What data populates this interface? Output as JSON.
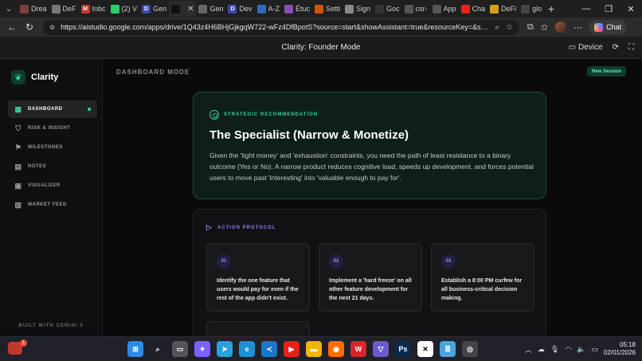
{
  "browser": {
    "tabs": [
      {
        "label": "Drea",
        "color": "#7b3f3f",
        "glyph": ""
      },
      {
        "label": "DeF",
        "color": "#777777",
        "glyph": ""
      },
      {
        "label": "Inbc",
        "color": "#c0392b",
        "glyph": "M"
      },
      {
        "label": "(2) V",
        "color": "#25d366",
        "glyph": ""
      },
      {
        "label": "Gen",
        "color": "#3c4aa8",
        "glyph": "D"
      },
      {
        "label": "",
        "color": "#111111",
        "glyph": "",
        "active": true
      },
      {
        "label": "Gen",
        "color": "#666666",
        "glyph": ""
      },
      {
        "label": "Dev",
        "color": "#3c4aa8",
        "glyph": "D"
      },
      {
        "label": "A-Z",
        "color": "#2f6bb8",
        "glyph": ""
      },
      {
        "label": "Étuc",
        "color": "#8a4fb0",
        "glyph": ""
      },
      {
        "label": "Setti",
        "color": "#d35400",
        "glyph": ""
      },
      {
        "label": "Sign",
        "color": "#888888",
        "glyph": ""
      },
      {
        "label": "Goc",
        "color": "#333333",
        "glyph": ""
      },
      {
        "label": "csr-",
        "color": "#555555",
        "glyph": ""
      },
      {
        "label": "App",
        "color": "#555555",
        "glyph": ""
      },
      {
        "label": "Cha",
        "color": "#e62117",
        "glyph": ""
      },
      {
        "label": "DeFi",
        "color": "#d4a017",
        "glyph": ""
      },
      {
        "label": "glo",
        "color": "#444444",
        "glyph": ""
      }
    ],
    "url": "https://aistudio.google.com/apps/drive/1Q43z4H6BHjGjkgqW722-wFz4DfBpotS?source=start&showAssistant=true&resourceKey=&sho...",
    "chat_label": "Chat"
  },
  "app_header": {
    "title": "Clarity: Founder Mode",
    "device_label": "Device"
  },
  "sidebar": {
    "brand": "Clarity",
    "items": [
      {
        "label": "DASHBOARD",
        "icon": "grid-icon",
        "glyph": "▦"
      },
      {
        "label": "RISK & INSIGHT",
        "icon": "shield-icon",
        "glyph": "⛉"
      },
      {
        "label": "MILESTONES",
        "icon": "flag-icon",
        "glyph": "⚑"
      },
      {
        "label": "NOTES",
        "icon": "document-icon",
        "glyph": "▤"
      },
      {
        "label": "VISUALIZER",
        "icon": "image-icon",
        "glyph": "▣"
      },
      {
        "label": "MARKET FEED",
        "icon": "newspaper-icon",
        "glyph": "▥"
      }
    ],
    "footer": "BUILT WITH GEMINI 3"
  },
  "main": {
    "mode_label": "DASHBOARD MODE",
    "new_session": "New Session",
    "recommendation": {
      "label": "STRATEGIC RECOMMENDATION",
      "title": "The Specialist (Narrow & Monetize)",
      "body": "Given the 'tight money' and 'exhaustion' constraints, you need the path of least resistance to a binary outcome (Yes or No). A narrow product reduces cognitive load, speeds up development, and forces potential users to move past 'interesting' into 'valuable enough to pay for'."
    },
    "protocol": {
      "label": "ACTION PROTOCOL",
      "steps": [
        {
          "num": "01",
          "text": "Identify the one feature that users would pay for even if the rest of the app didn't exist."
        },
        {
          "num": "02",
          "text": "Implement a 'hard freeze' on all other feature development for the next 21 days."
        },
        {
          "num": "03",
          "text": "Establish a 8:00 PM curfew for all business-critical decision making."
        }
      ]
    }
  },
  "taskbar": {
    "badge": "1",
    "time": "05:18",
    "date": "02/01/2026",
    "apps": [
      {
        "name": "windows-start-icon",
        "color": "#2b8be6",
        "glyph": "⊞"
      },
      {
        "name": "search-icon",
        "color": "#202028",
        "glyph": "⌕"
      },
      {
        "name": "task-view-icon",
        "color": "#555555",
        "glyph": "▭"
      },
      {
        "name": "copilot-icon",
        "color": "#7b61ff",
        "glyph": "✦"
      },
      {
        "name": "telegram-icon",
        "color": "#2aa1da",
        "glyph": "➤"
      },
      {
        "name": "edge-icon",
        "color": "#1f8fd6",
        "glyph": "e"
      },
      {
        "name": "vscode-icon",
        "color": "#1e76c8",
        "glyph": "≺"
      },
      {
        "name": "youtube-icon",
        "color": "#e62117",
        "glyph": "▶"
      },
      {
        "name": "file-explorer-icon",
        "color": "#f2b400",
        "glyph": "▬"
      },
      {
        "name": "firefox-icon",
        "color": "#ff6d00",
        "glyph": "◉"
      },
      {
        "name": "wps-icon",
        "color": "#d6262b",
        "glyph": "W"
      },
      {
        "name": "vpn-icon",
        "color": "#6a5acd",
        "glyph": "▽"
      },
      {
        "name": "photoshop-icon",
        "color": "#0c2a4a",
        "glyph": "Ps"
      },
      {
        "name": "capcut-icon",
        "color": "#ffffff",
        "glyph": "✕"
      },
      {
        "name": "notepad-icon",
        "color": "#4aa3df",
        "glyph": "≣"
      },
      {
        "name": "chrome-icon",
        "color": "#444444",
        "glyph": "◎"
      }
    ]
  },
  "colors": {
    "accent_green": "#35d49a",
    "accent_purple": "#8c82ff"
  }
}
